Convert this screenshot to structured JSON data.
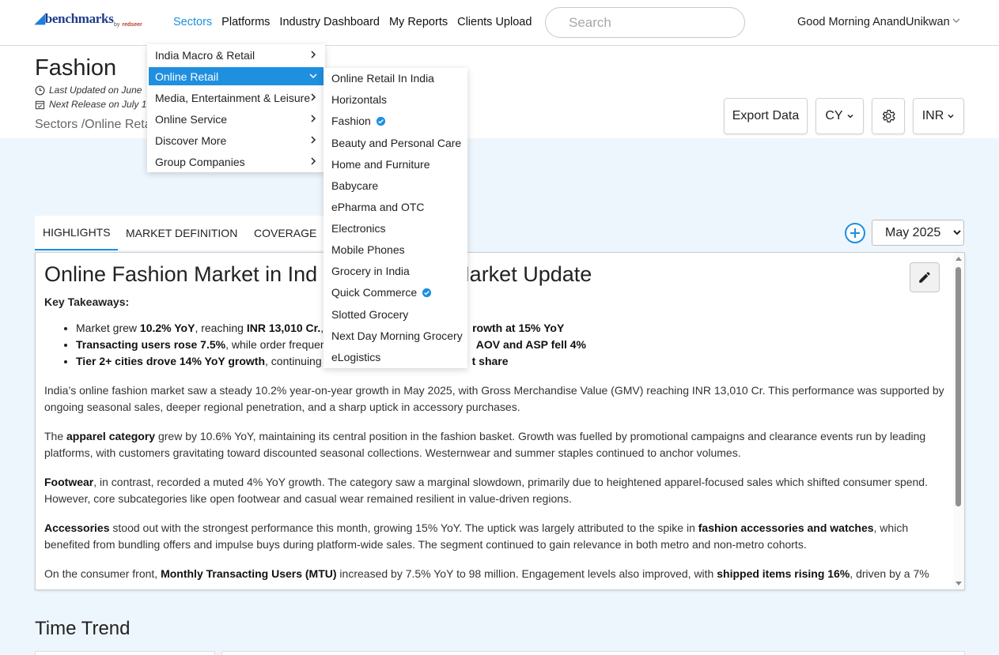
{
  "brand": {
    "name": "benchmarks",
    "by": "by",
    "partner": "redseer"
  },
  "nav": [
    "Sectors",
    "Platforms",
    "Industry Dashboard",
    "My Reports",
    "Clients Upload"
  ],
  "search": {
    "placeholder": "Search"
  },
  "user": {
    "greeting": "Good Morning AnandUnikwan"
  },
  "page": {
    "title": "Fashion",
    "last_updated": "Last Updated on June",
    "next_release": "Next Release on July 1",
    "breadcrumb": "Sectors /Online Retai"
  },
  "toolbar": {
    "export": "Export Data",
    "period": "CY",
    "currency": "INR"
  },
  "menu_level1": [
    "India Macro & Retail",
    "Online Retail",
    "Media, Entertainment & Leisure",
    "Online Service",
    "Discover More",
    "Group Companies"
  ],
  "menu_level2": [
    "Online Retail In India",
    "Horizontals",
    "Fashion",
    "Beauty and Personal Care",
    "Home and Furniture",
    "Babycare",
    "ePharma and OTC",
    "Electronics",
    "Mobile Phones",
    "Grocery in India",
    "Quick Commerce",
    "Slotted Grocery",
    "Next Day Morning Grocery",
    "eLogistics"
  ],
  "tabs": [
    "HIGHLIGHTS",
    "MARKET DEFINITION",
    "COVERAGE"
  ],
  "month": {
    "selected": "May 2025"
  },
  "content": {
    "heading_left": "Online Fashion Market in Ind",
    "heading_right": "Market Update",
    "key_takeaways": "Key Takeaways:",
    "b1_pre": "Market grew ",
    "b1_b1": "10.2% YoY",
    "b1_mid": ", reaching ",
    "b1_b2": "INR 13,010 Cr.",
    "b1_post": ",",
    "b1_tail": "rowth at 15% YoY",
    "b2_b1": "Transacting users rose 7.5%",
    "b2_mid": ", while order frequen",
    "b2_tail": "AOV and ASP fell 4%",
    "b3_b1": "Tier 2+ cities drove 14% YoY growth",
    "b3_mid": ", continuing",
    "b3_tail": "t share",
    "p1": "India’s online fashion market saw a steady 10.2% year-on-year growth in May 2025, with Gross Merchandise Value (GMV) reaching INR 13,010 Cr. This performance was supported by ongoing seasonal sales, deeper regional penetration, and a sharp uptick in accessory purchases.",
    "p2_pre": "The ",
    "p2_b": "apparel category",
    "p2_post": " grew by 10.6% YoY, maintaining its central position in the fashion basket. Growth was fuelled by promotional campaigns and clearance events run by leading platforms, with customers gravitating toward discounted seasonal collections. Westernwear and summer staples continued to anchor volumes.",
    "p3_b": "Footwear",
    "p3_post": ", in contrast, recorded a muted 4% YoY growth. The category saw a marginal slowdown, primarily due to heightened apparel-focused sales which shifted consumer spend. However, core subcategories like open footwear and casual wear remained resilient in value-driven regions.",
    "p4_b": "Accessories",
    "p4_mid": " stood out with the strongest performance this month, growing 15% YoY. The uptick was largely attributed to the spike in ",
    "p4_b2": "fashion accessories and watches",
    "p4_post": ", which benefited from bundling offers and impulse buys during platform-wide sales. The segment continued to gain relevance in both metro and non-metro cohorts.",
    "p5_pre": "On the consumer front, ",
    "p5_b": "Monthly Transacting Users (MTU)",
    "p5_mid": " increased by 7.5% YoY to 98 million. Engagement levels also improved, with ",
    "p5_b2": "shipped items rising 16%",
    "p5_post": ", driven by a 7%"
  },
  "section": {
    "time_trend": "Time Trend"
  },
  "colors": {
    "accent": "#1f8fe0",
    "band": "#eef6fd"
  }
}
